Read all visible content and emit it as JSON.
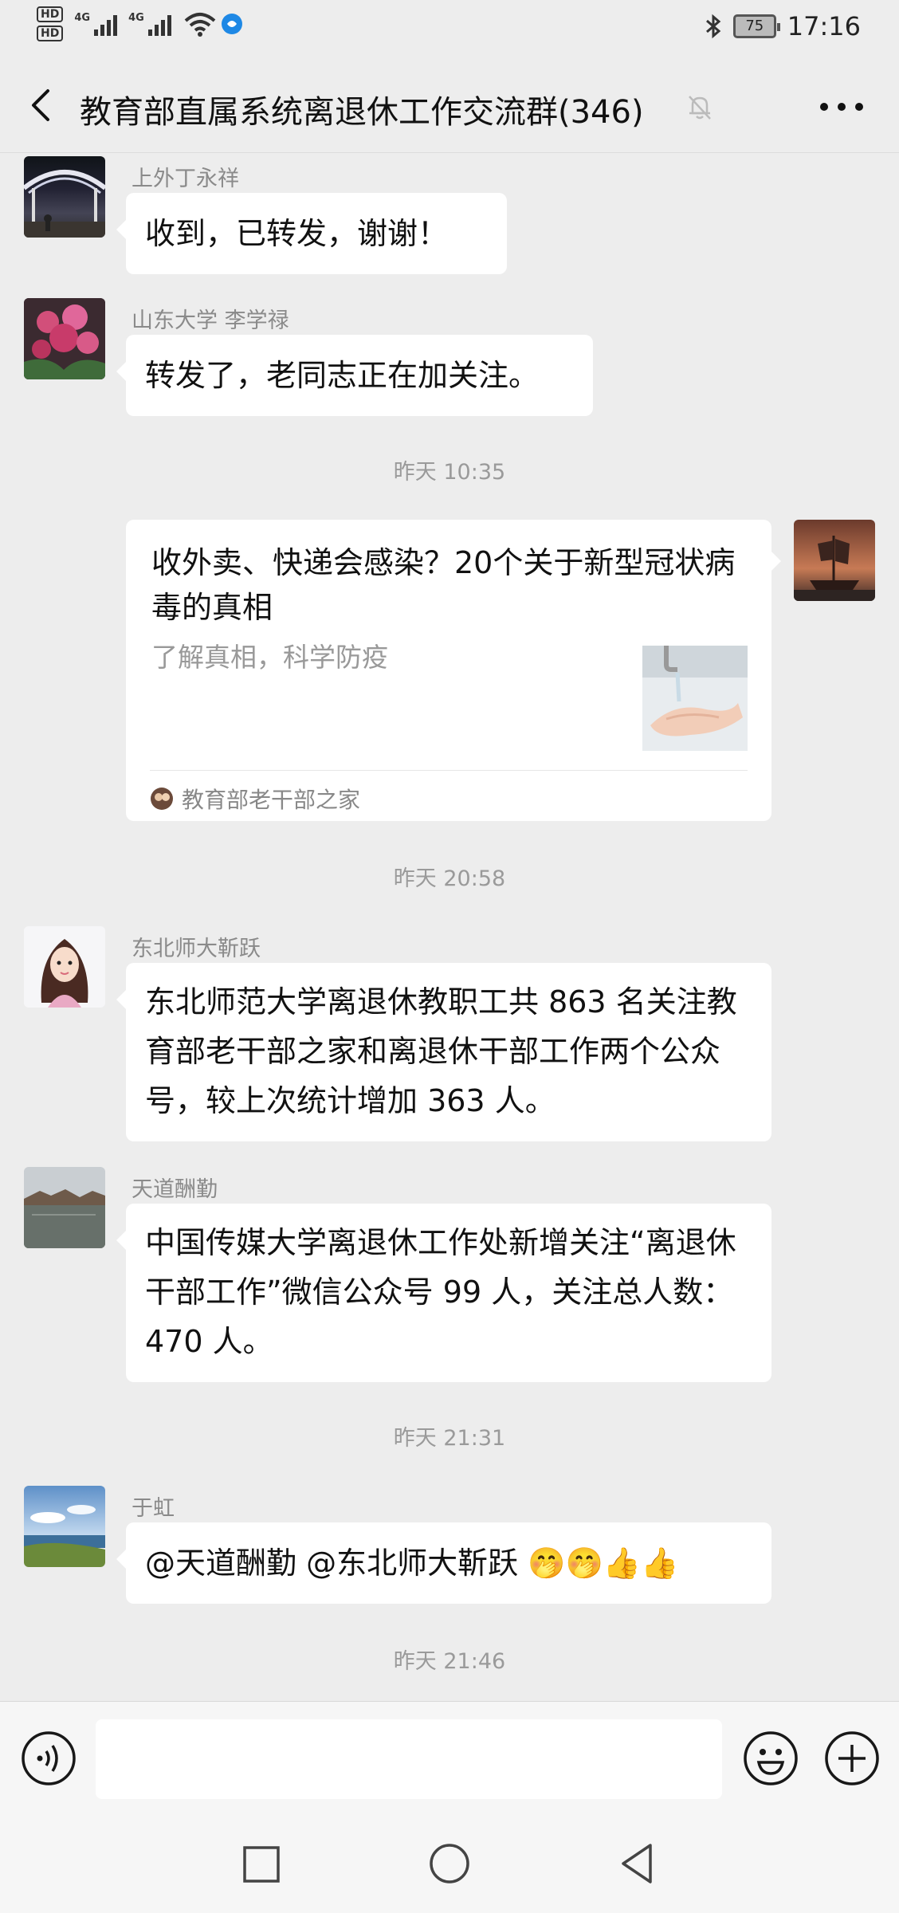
{
  "status": {
    "time": "17:16",
    "battery": "75",
    "net1": "4G",
    "net2": "4G",
    "hd1": "HD",
    "hd2": "HD"
  },
  "nav": {
    "title": "教育部直属系统离退休工作交流群(346)"
  },
  "messages": {
    "m1": {
      "sender": "上外丁永祥",
      "text": "收到，已转发，谢谢！"
    },
    "m2": {
      "sender": "山东大学 李学禄",
      "text": "转发了，老同志正在加关注。"
    },
    "t1": "昨天 10:35",
    "card": {
      "title": "收外卖、快递会感染？20个关于新型冠状病毒的真相",
      "desc": "了解真相，科学防疫",
      "source": "教育部老干部之家"
    },
    "t2": "昨天 20:58",
    "m3": {
      "sender": "东北师大靳跃",
      "text": "东北师范大学离退休教职工共 863 名关注教育部老干部之家和离退休干部工作两个公众号，较上次统计增加 363 人。"
    },
    "m4": {
      "sender": "天道酬勤",
      "text": "中国传媒大学离退休工作处新增关注“离退休干部工作”微信公众号 99 人，关注总人数：470 人。"
    },
    "t3": "昨天 21:31",
    "m5": {
      "sender": "于虹",
      "text": "@天道酬勤  @东北师大靳跃  🤭🤭👍👍"
    },
    "t4": "昨天 21:46"
  },
  "colors": {
    "background": "#ededed",
    "bubble": "#ffffff",
    "meta_text": "#9a9a9a"
  }
}
